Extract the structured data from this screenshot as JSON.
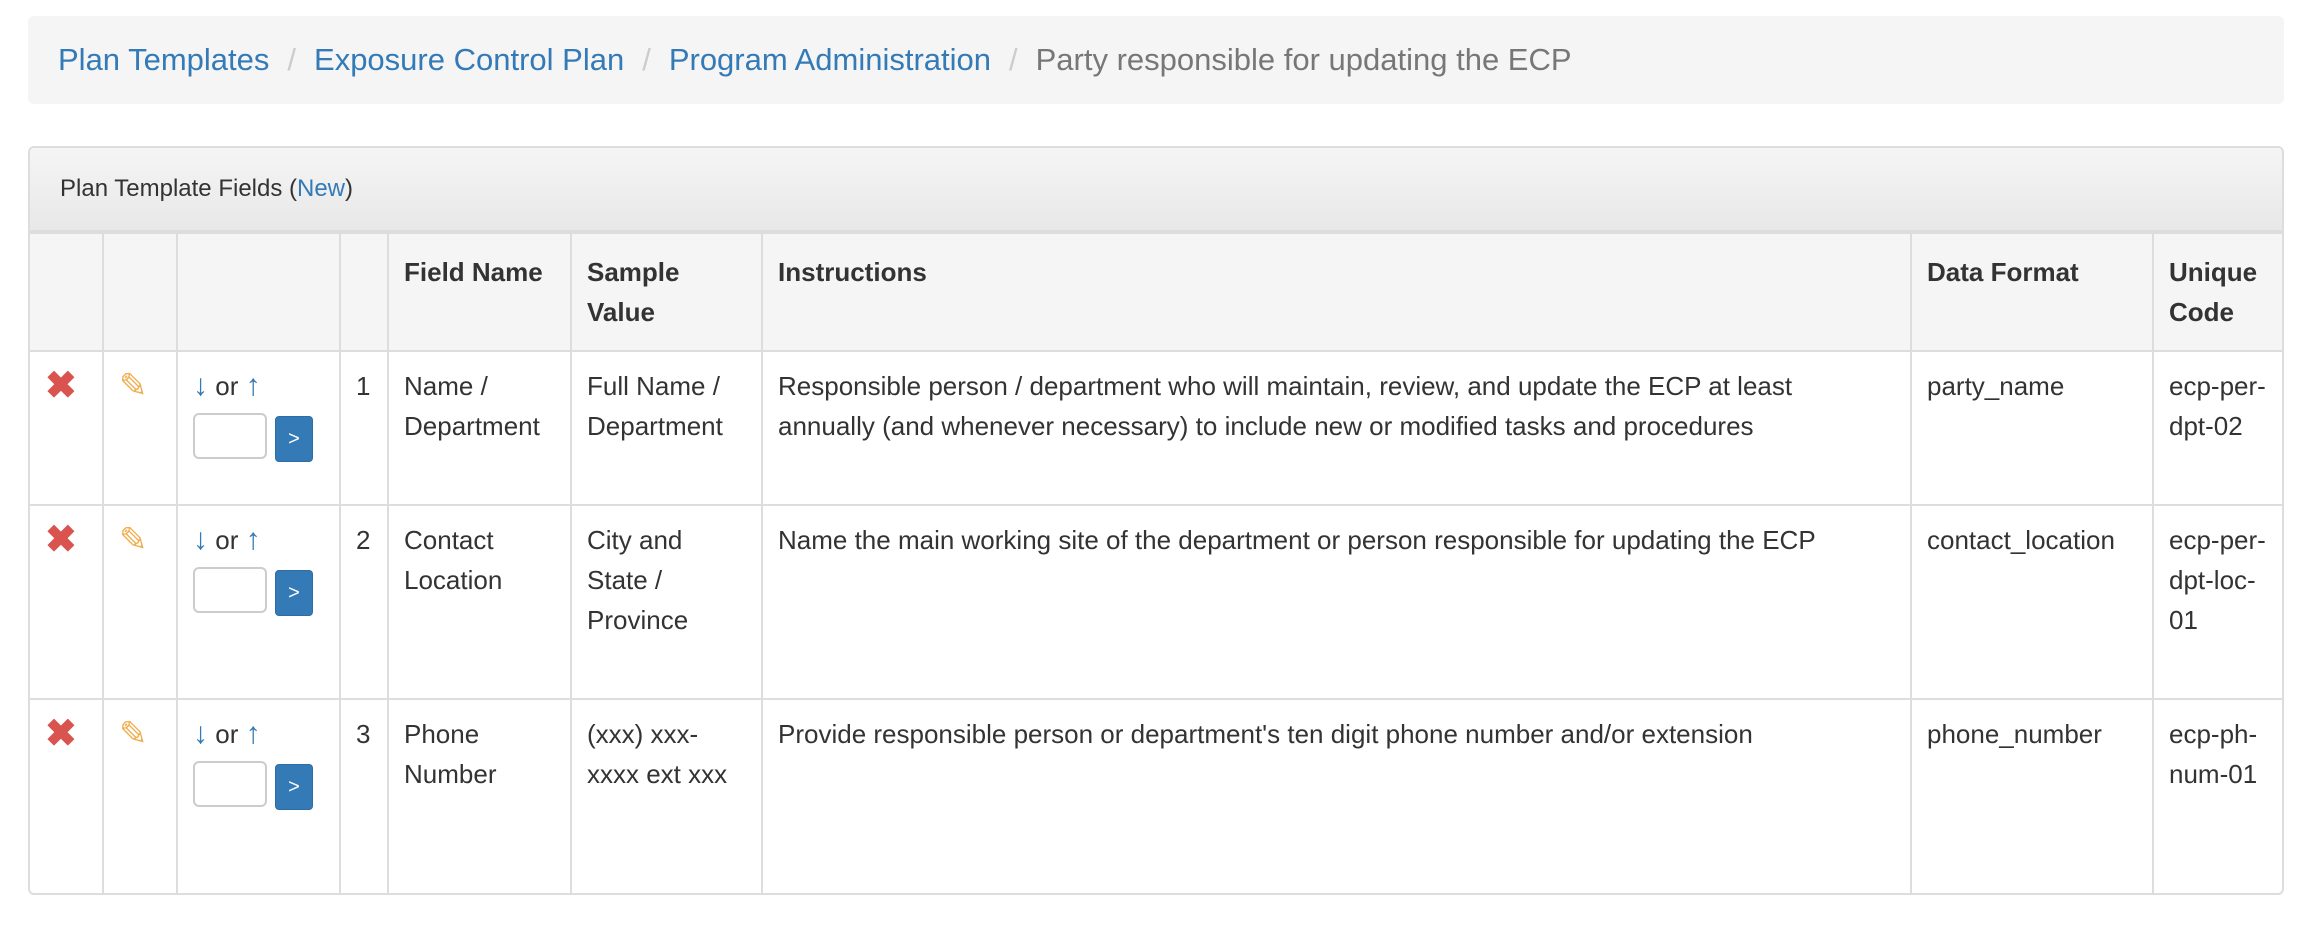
{
  "breadcrumb": {
    "items": [
      "Plan Templates",
      "Exposure Control Plan",
      "Program Administration"
    ],
    "current": "Party responsible for updating the ECP"
  },
  "panel": {
    "title": "Plan Template Fields (",
    "new_link": "New",
    "title_end": ")"
  },
  "table": {
    "headers": [
      "",
      "",
      "",
      "",
      "Field Name",
      "Sample Value",
      "Instructions",
      "Data Format",
      "Unique Code"
    ],
    "or_label": "or",
    "move_button": ">",
    "rows": [
      {
        "num": "1",
        "field_name": "Name / Department",
        "sample": "Full Name / Department",
        "instructions": "Responsible person / department who will maintain, review, and update the ECP at least annually (and whenever necessary) to include new or modified tasks and procedures",
        "format": "party_name",
        "code": "ecp-per-dpt-02"
      },
      {
        "num": "2",
        "field_name": "Contact Location",
        "sample": "City and State / Province",
        "instructions": "Name the main working site of the department or person responsible for updating the ECP",
        "format": "contact_location",
        "code": "ecp-per-dpt-loc-01"
      },
      {
        "num": "3",
        "field_name": "Phone Number",
        "sample": "(xxx) xxx-xxxx ext xxx",
        "instructions": "Provide responsible person or department's ten digit phone number and/or extension",
        "format": "phone_number",
        "code": "ecp-ph-num-01"
      }
    ]
  },
  "icons": {
    "delete": "times-icon",
    "edit": "pencil-icon",
    "down": "arrow-down-icon",
    "up": "arrow-up-icon"
  },
  "colors": {
    "link": "#337ab7",
    "delete": "#d9534f",
    "edit": "#f0ad4e"
  }
}
